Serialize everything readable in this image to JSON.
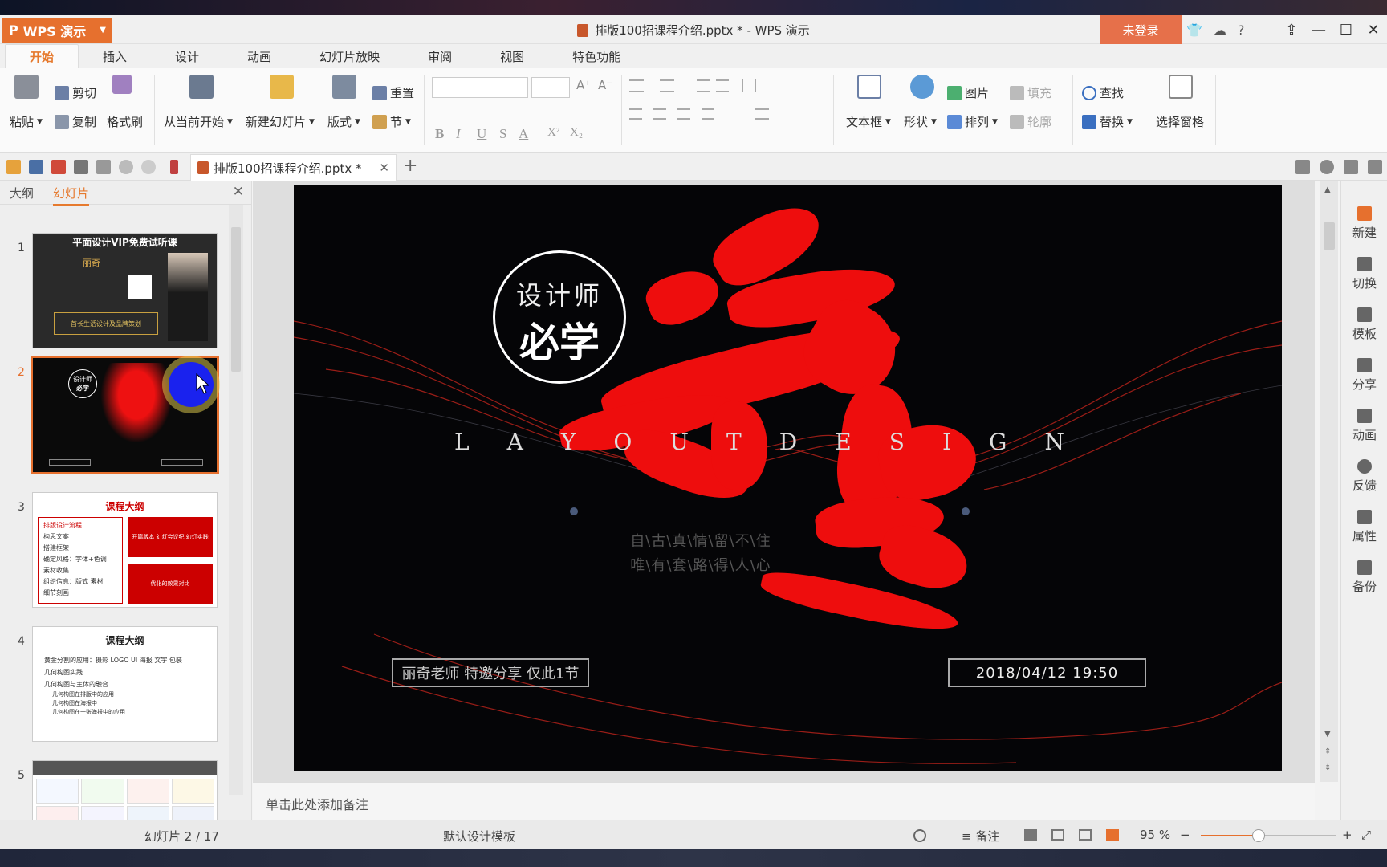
{
  "app": {
    "name": "WPS 演示",
    "title": "排版100招课程介绍.pptx * - WPS 演示",
    "login": "未登录",
    "help": "?"
  },
  "menu": {
    "tabs": [
      "开始",
      "插入",
      "设计",
      "动画",
      "幻灯片放映",
      "审阅",
      "视图",
      "特色功能"
    ]
  },
  "ribbon": {
    "paste": "粘贴",
    "cut": "剪切",
    "copy": "复制",
    "format_painter": "格式刷",
    "from_current": "从当前开始",
    "new_slide": "新建幻灯片",
    "layout": "版式",
    "reset": "重置",
    "section": "节",
    "textbox": "文本框",
    "shape": "形状",
    "picture": "图片",
    "fill": "填充",
    "arrange": "排列",
    "outline": "轮廓",
    "find": "查找",
    "replace": "替换",
    "selection_pane": "选择窗格",
    "fmt_bold": "B",
    "fmt_italic": "I",
    "fmt_underline": "U",
    "fmt_strike": "S",
    "fmt_color": "A",
    "fmt_sup": "X²",
    "fmt_sub": "X₂",
    "grow_font": "A⁺",
    "shrink_font": "A⁻"
  },
  "doc_tab": {
    "label": "排版100招课程介绍.pptx *",
    "close": "✕",
    "add": "+"
  },
  "left_panel": {
    "tab_outline": "大纲",
    "tab_slides": "幻灯片",
    "close": "✕",
    "slides": [
      {
        "num": "1",
        "title": "平面设计VIP免费试听课",
        "name": "丽奇",
        "footer": "首长生活设计及品牌策划"
      },
      {
        "num": "2",
        "circle_top": "设计师",
        "circle_bottom": "必学"
      },
      {
        "num": "3",
        "title": "课程大纲",
        "items": [
          "排版设计流程",
          "构思文案",
          "搭建框架",
          "确定风格：字体+色调",
          "素材收集",
          "组织信息：版式 素材",
          "细节刻画"
        ],
        "box1": "开篇版本 幻灯会议纪 幻灯实践",
        "box2": "优化的效果对比"
      },
      {
        "num": "4",
        "title": "课程大纲",
        "items": [
          "黄金分割的应用：摄影 LOGO UI 海报 文字 包装",
          "几何构图实践",
          "几何构图与主体的融合"
        ],
        "subitems": [
          "几何构图在排版中的应用",
          "几何构图在海报中",
          "几何构图在一张海报中的应用"
        ]
      },
      {
        "num": "5"
      }
    ]
  },
  "slide": {
    "circle_top": "设计师",
    "circle_bottom": "必学",
    "layout_letters": [
      "L",
      "A",
      "Y",
      "O",
      "U",
      "T",
      "D",
      "E",
      "S",
      "I",
      "G",
      "N"
    ],
    "poem_line1": "自\\古\\真\\情\\留\\不\\住",
    "poem_line2": "唯\\有\\套\\路\\得\\人\\心",
    "box_left": "丽奇老师  特邀分享  仅此1节",
    "box_right": "2018/04/12  19:50"
  },
  "notes_placeholder": "单击此处添加备注",
  "right_bar": [
    "新建",
    "切换",
    "模板",
    "分享",
    "动画",
    "反馈",
    "属性",
    "备份"
  ],
  "status": {
    "slide_count": "幻灯片 2 / 17",
    "template": "默认设计模板",
    "notes": "备注",
    "zoom": "95 %",
    "zoom_level": 0.43
  }
}
